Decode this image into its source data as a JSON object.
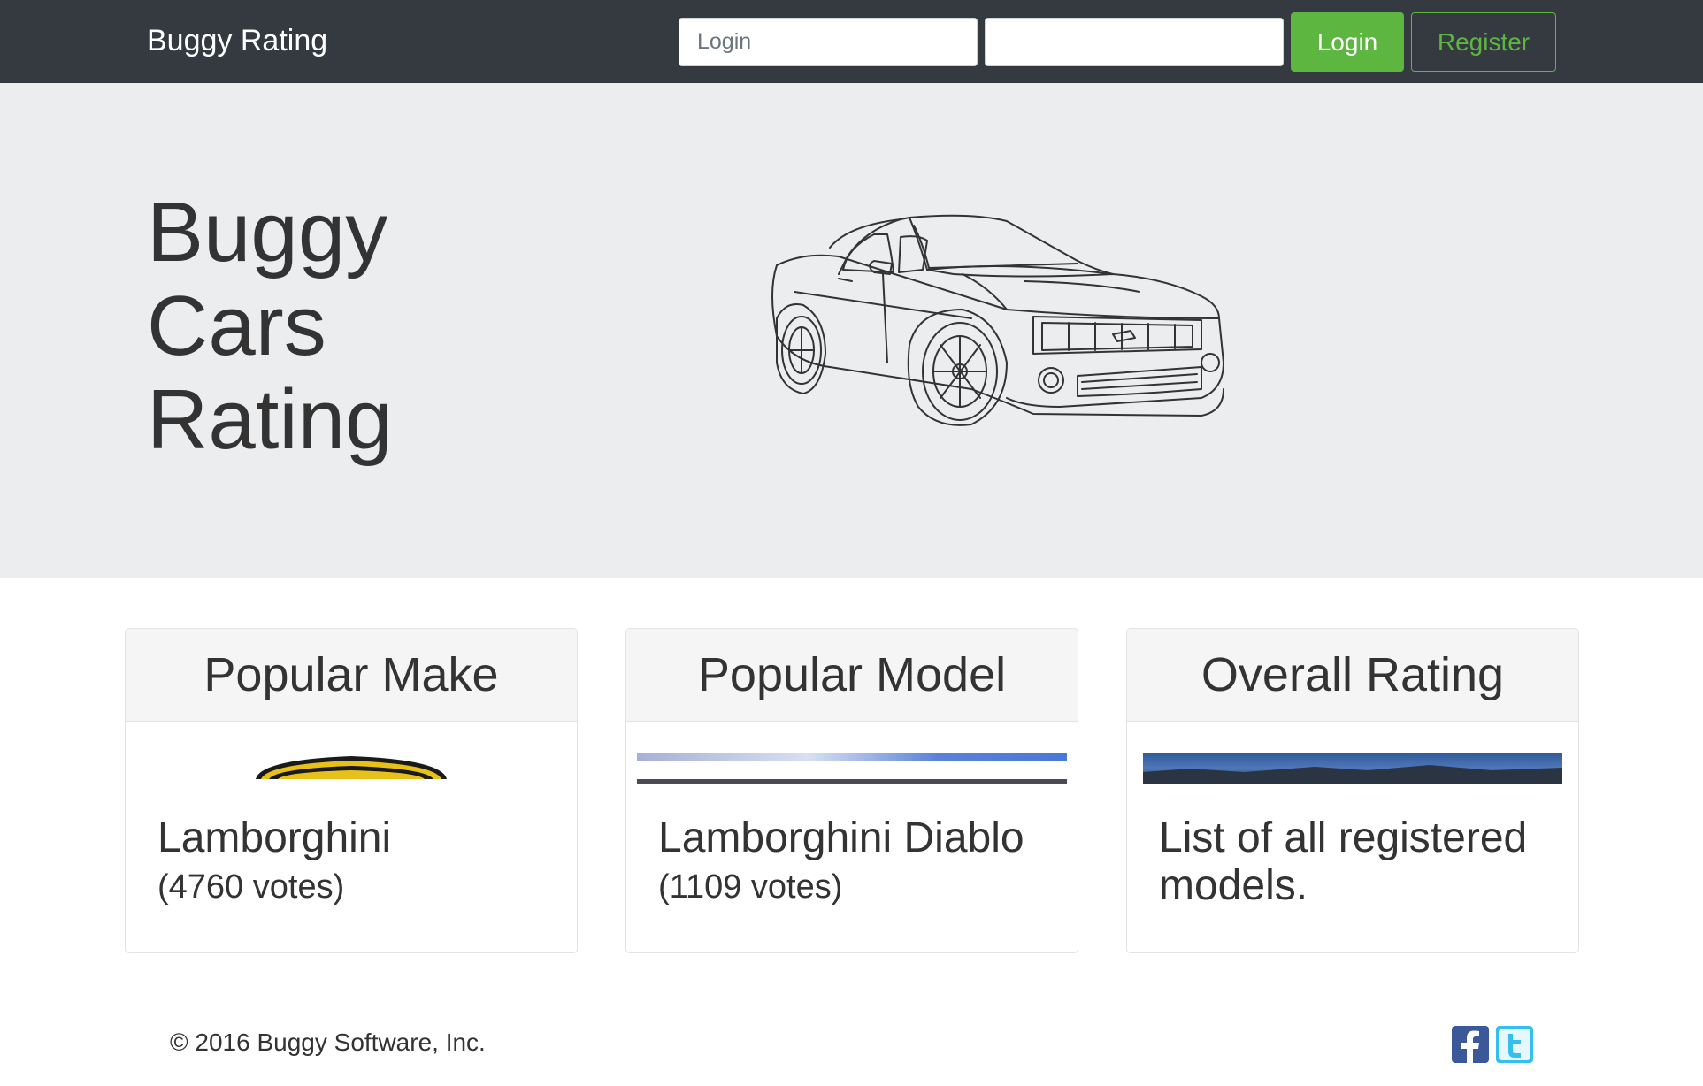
{
  "navbar": {
    "brand": "Buggy Rating",
    "login_placeholder": "Login",
    "password_value": "",
    "login_button": "Login",
    "register_button": "Register",
    "colors": {
      "background": "#343a40",
      "accent": "#5cb63f"
    }
  },
  "hero": {
    "title": "Buggy Cars Rating",
    "image": "car-sketch-image",
    "background": "#ecedee"
  },
  "cards": {
    "make": {
      "header": "Popular Make",
      "name": "Lamborghini",
      "votes": "(4760 votes)",
      "image": "lamborghini-logo-image"
    },
    "model": {
      "header": "Popular Model",
      "name": "Lamborghini Diablo",
      "votes": "(1109 votes)",
      "image": "diablo-photo-image"
    },
    "overall": {
      "header": "Overall Rating",
      "text": "List of all registered models.",
      "image": "landscape-photo-image"
    }
  },
  "footer": {
    "copyright": "© 2016 Buggy Software, Inc.",
    "social": [
      "facebook-icon",
      "twitter-icon"
    ]
  }
}
